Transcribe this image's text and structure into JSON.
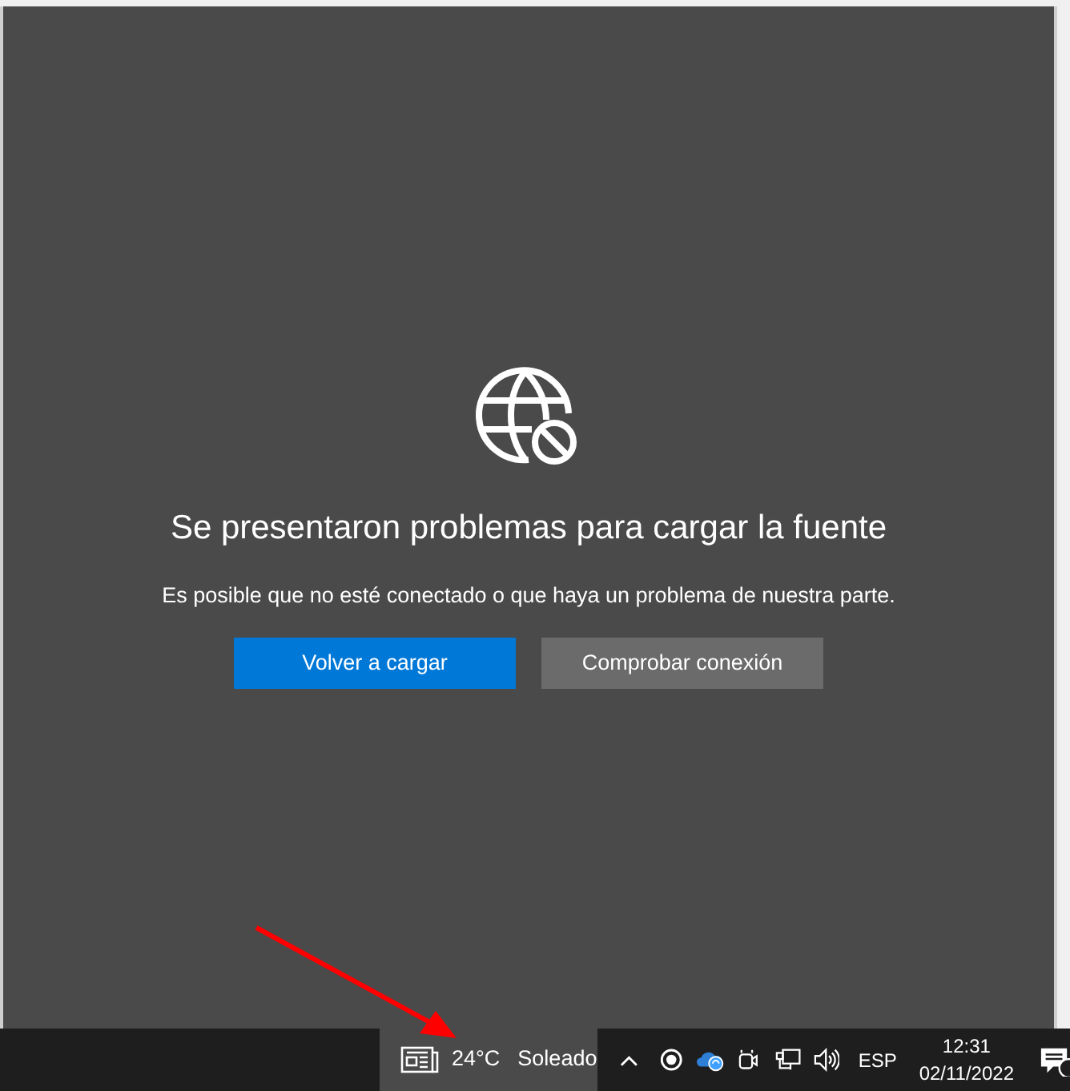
{
  "error_page": {
    "title": "Se presentaron problemas para cargar la fuente",
    "message": "Es posible que no esté conectado o que haya un problema de nuestra parte.",
    "buttons": [
      {
        "label": "Volver a cargar",
        "kind": "primary"
      },
      {
        "label": "Comprobar conexión",
        "kind": "secondary"
      }
    ]
  },
  "taskbar": {
    "weather": {
      "temperature": "24°C",
      "condition": "Soleado"
    },
    "language": "ESP",
    "time": "12:31",
    "date": "02/11/2022"
  }
}
